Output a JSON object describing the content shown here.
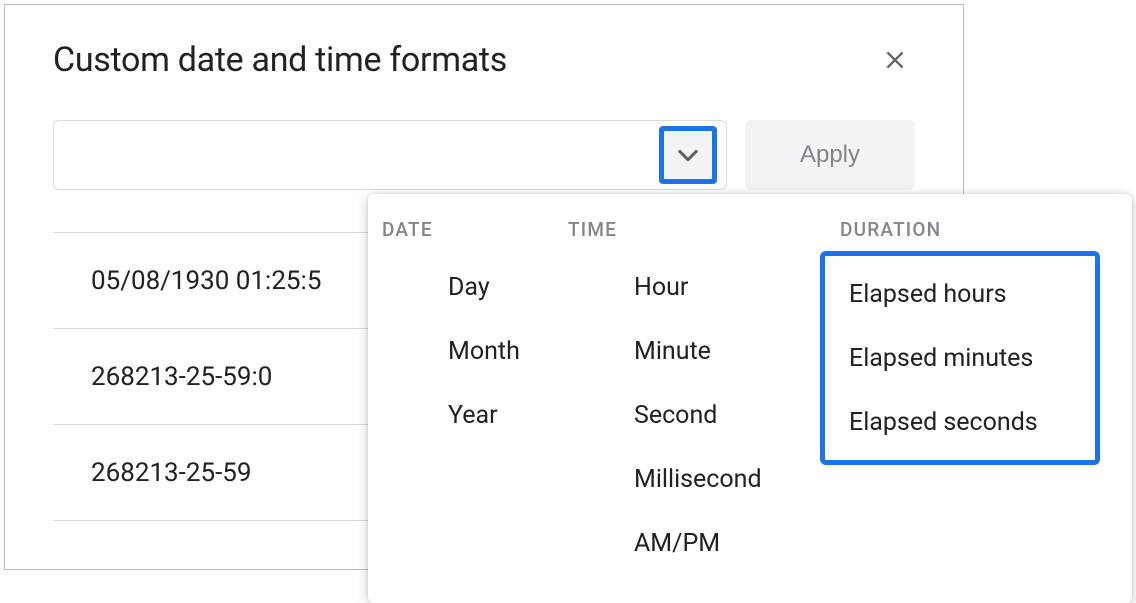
{
  "dialog": {
    "title": "Custom date and time formats",
    "apply_label": "Apply"
  },
  "presets": [
    "05/08/1930 01:25:5",
    "268213-25-59:0",
    "268213-25-59"
  ],
  "dropdown": {
    "date": {
      "header": "DATE",
      "items": [
        "Day",
        "Month",
        "Year"
      ]
    },
    "time": {
      "header": "TIME",
      "items": [
        "Hour",
        "Minute",
        "Second",
        "Millisecond",
        "AM/PM"
      ]
    },
    "duration": {
      "header": "DURATION",
      "items": [
        "Elapsed hours",
        "Elapsed minutes",
        "Elapsed seconds"
      ]
    }
  }
}
